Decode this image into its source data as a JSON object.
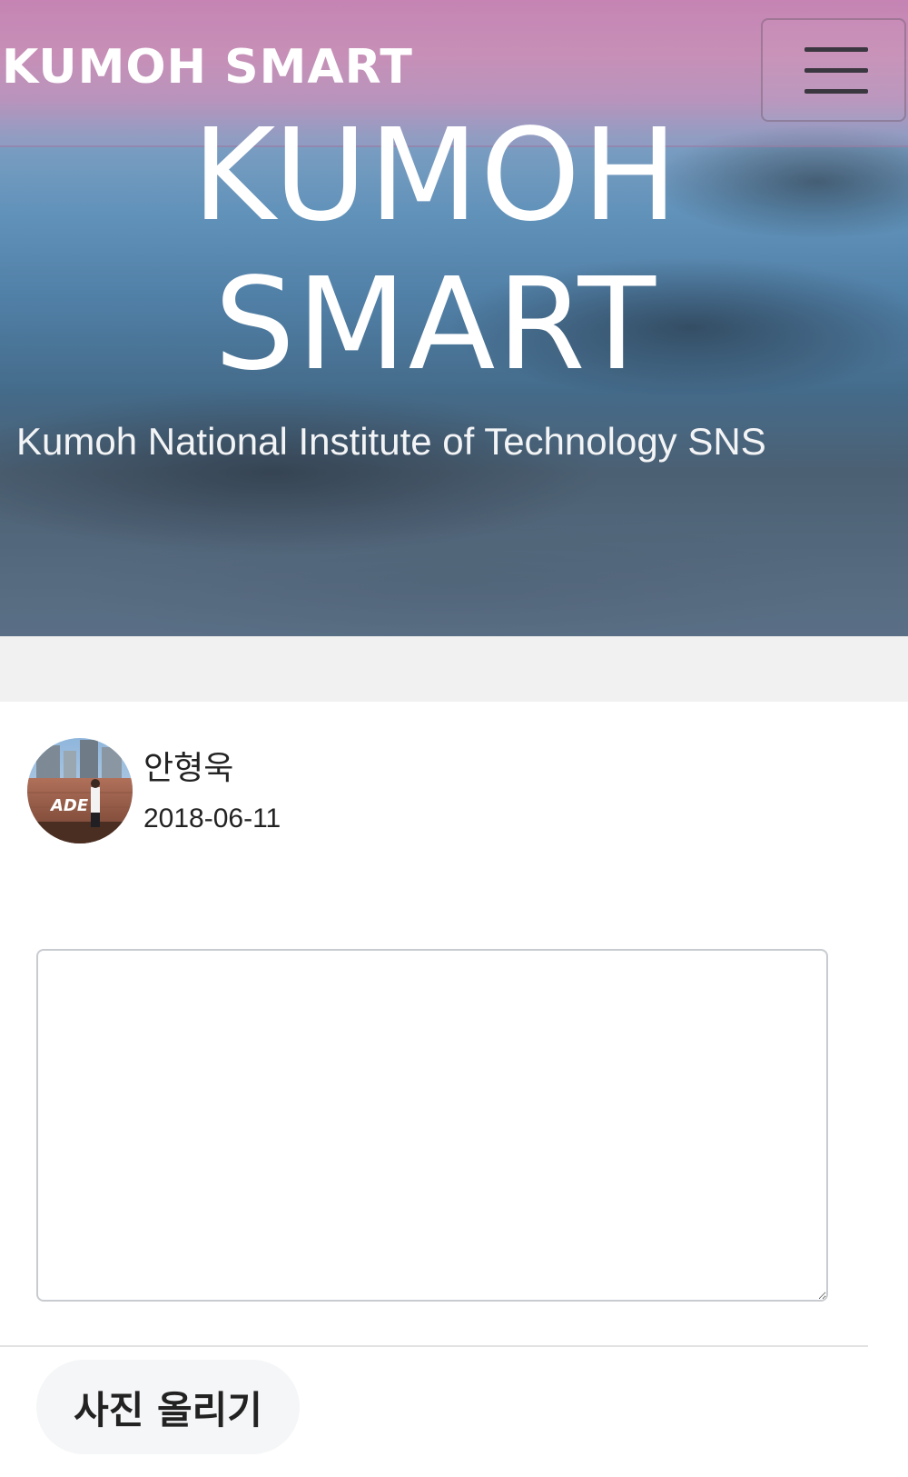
{
  "navbar": {
    "brand": "KUMOH SMART",
    "menu_icon": "hamburger-menu-icon"
  },
  "hero": {
    "title_line1": "KUMOH",
    "title_line2": "SMART",
    "subtitle": "Kumoh National Institute of Technology SNS"
  },
  "post": {
    "user_name": "안형욱",
    "date": "2018-06-11",
    "textarea_value": "",
    "upload_button_label": "사진 올리기"
  },
  "avatar": {
    "overlay_text": "ADE"
  },
  "colors": {
    "hero_pink": "#d98fc2",
    "hero_blue": "#6fa5cf",
    "band_gray": "#f1f1f1",
    "button_bg": "#f5f6f7",
    "text_dark": "#222222"
  }
}
